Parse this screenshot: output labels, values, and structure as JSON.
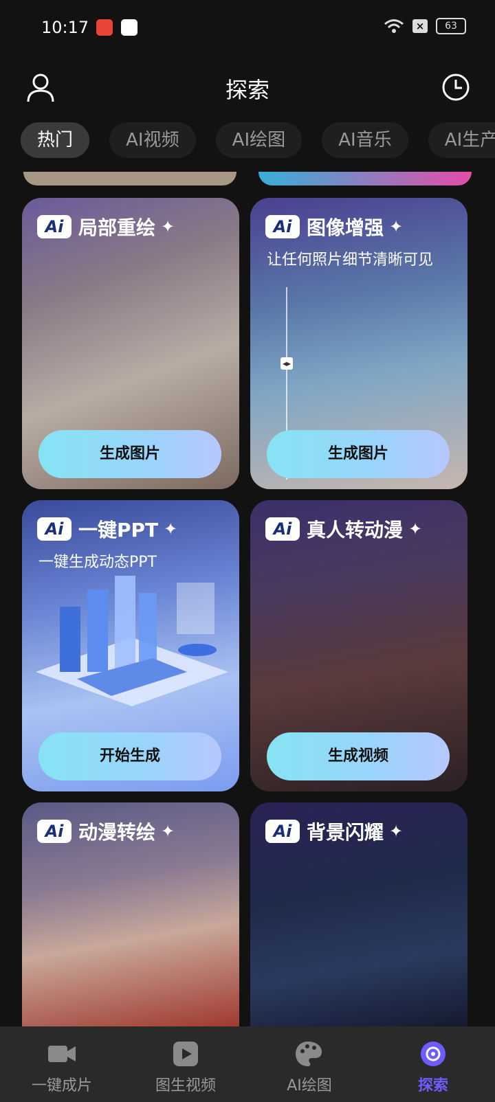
{
  "status_bar": {
    "time": "10:17",
    "battery": "63"
  },
  "header": {
    "title": "探索"
  },
  "tabs": [
    {
      "label": "热门",
      "active": true
    },
    {
      "label": "AI视频",
      "active": false
    },
    {
      "label": "AI绘图",
      "active": false
    },
    {
      "label": "AI音乐",
      "active": false
    },
    {
      "label": "AI生产",
      "active": false
    }
  ],
  "badge": "Ai",
  "spark": "✦",
  "cards": [
    {
      "title": "局部重绘",
      "subtitle": "",
      "button": "生成图片"
    },
    {
      "title": "图像增强",
      "subtitle": "让任何照片细节清晰可见",
      "button": "生成图片"
    },
    {
      "title": "一键PPT",
      "subtitle": "一键生成动态PPT",
      "button": "开始生成"
    },
    {
      "title": "真人转动漫",
      "subtitle": "",
      "button": "生成视频"
    },
    {
      "title": "动漫转绘",
      "subtitle": "",
      "button": ""
    },
    {
      "title": "背景闪耀",
      "subtitle": "",
      "button": ""
    }
  ],
  "bottom_nav": [
    {
      "label": "一键成片",
      "icon": "video-camera-icon",
      "active": false
    },
    {
      "label": "图生视频",
      "icon": "play-icon",
      "active": false
    },
    {
      "label": "AI绘图",
      "icon": "palette-icon",
      "active": false
    },
    {
      "label": "探索",
      "icon": "explore-icon",
      "active": true
    }
  ],
  "colors": {
    "accent": "#6f5cff",
    "button_gradient_start": "#86e3f3",
    "button_gradient_end": "#b7c7ff"
  }
}
